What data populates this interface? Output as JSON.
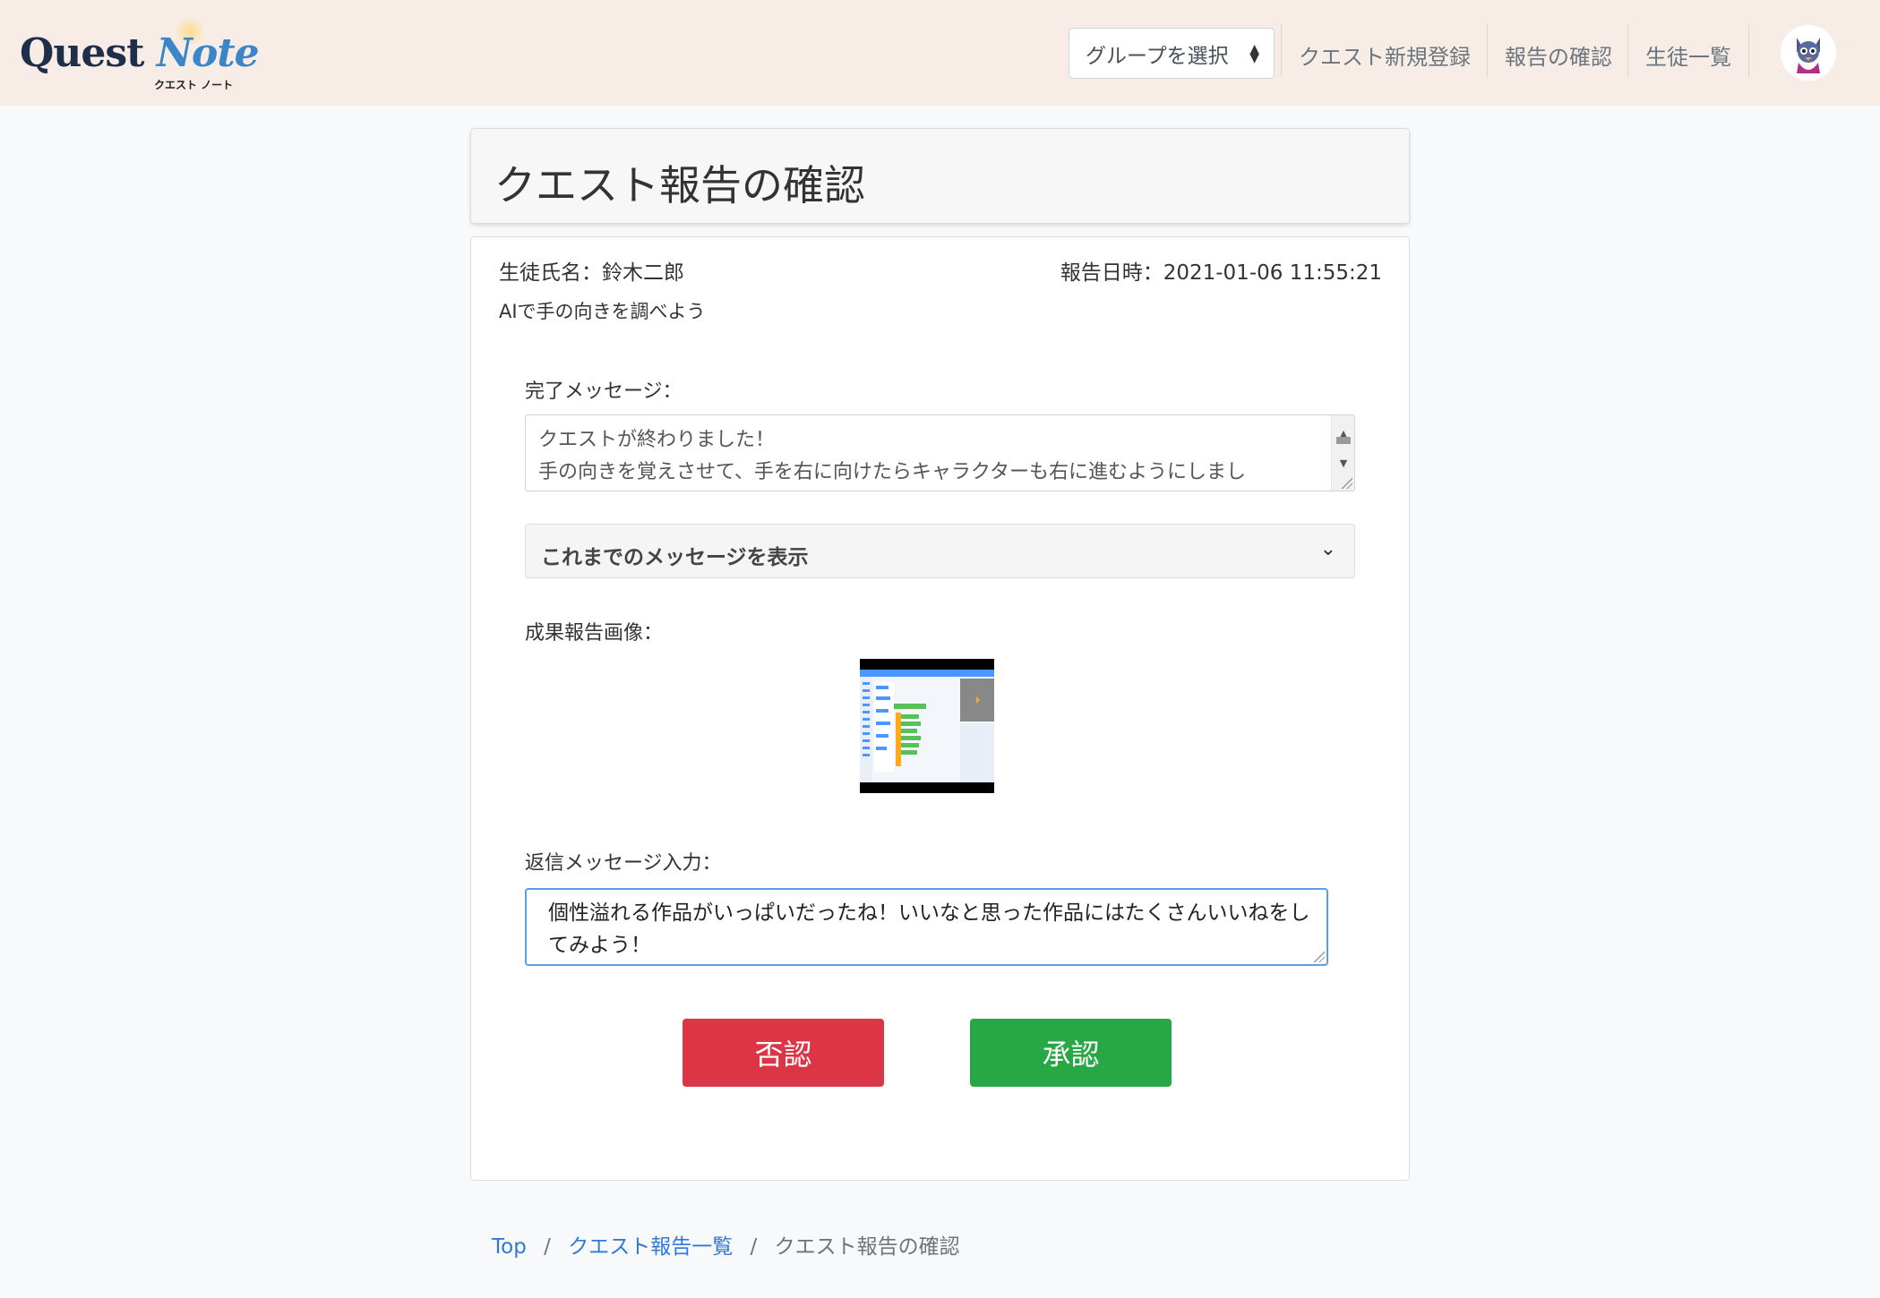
{
  "header": {
    "logo_text_q": "Quest",
    "logo_text_n": "Note",
    "logo_sub": "クエスト ノート",
    "group_select": "グループを選択",
    "nav": [
      "クエスト新規登録",
      "報告の確認",
      "生徒一覧"
    ],
    "brand_color": "#f7ede6"
  },
  "page": {
    "title": "クエスト報告の確認"
  },
  "report": {
    "student": "生徒氏名：鈴木二郎",
    "date": "報告日時：2021-01-06 11:55:21",
    "quest_title": "AIで手の向きを調べよう",
    "completion_label": "完了メッセージ：",
    "completion_line1": "クエストが終わりました！",
    "completion_line2": "手の向きを覚えさせて、手を右に向けたらキャラクターも右に進むようにしまし",
    "history_toggle": "これまでのメッセージを表示",
    "image_label": "成果報告画像：",
    "reply_label": "返信メッセージ入力：",
    "reply_value": "個性溢れる作品がいっぱいだったね！いいなと思った作品にはたくさんいいねをしてみよう！",
    "reject_button": "否認",
    "approve_button": "承認",
    "reject_color": "#dc3545",
    "approve_color": "#28a745"
  },
  "breadcrumb": {
    "items": [
      "Top",
      "クエスト報告一覧",
      "クエスト報告の確認"
    ]
  }
}
